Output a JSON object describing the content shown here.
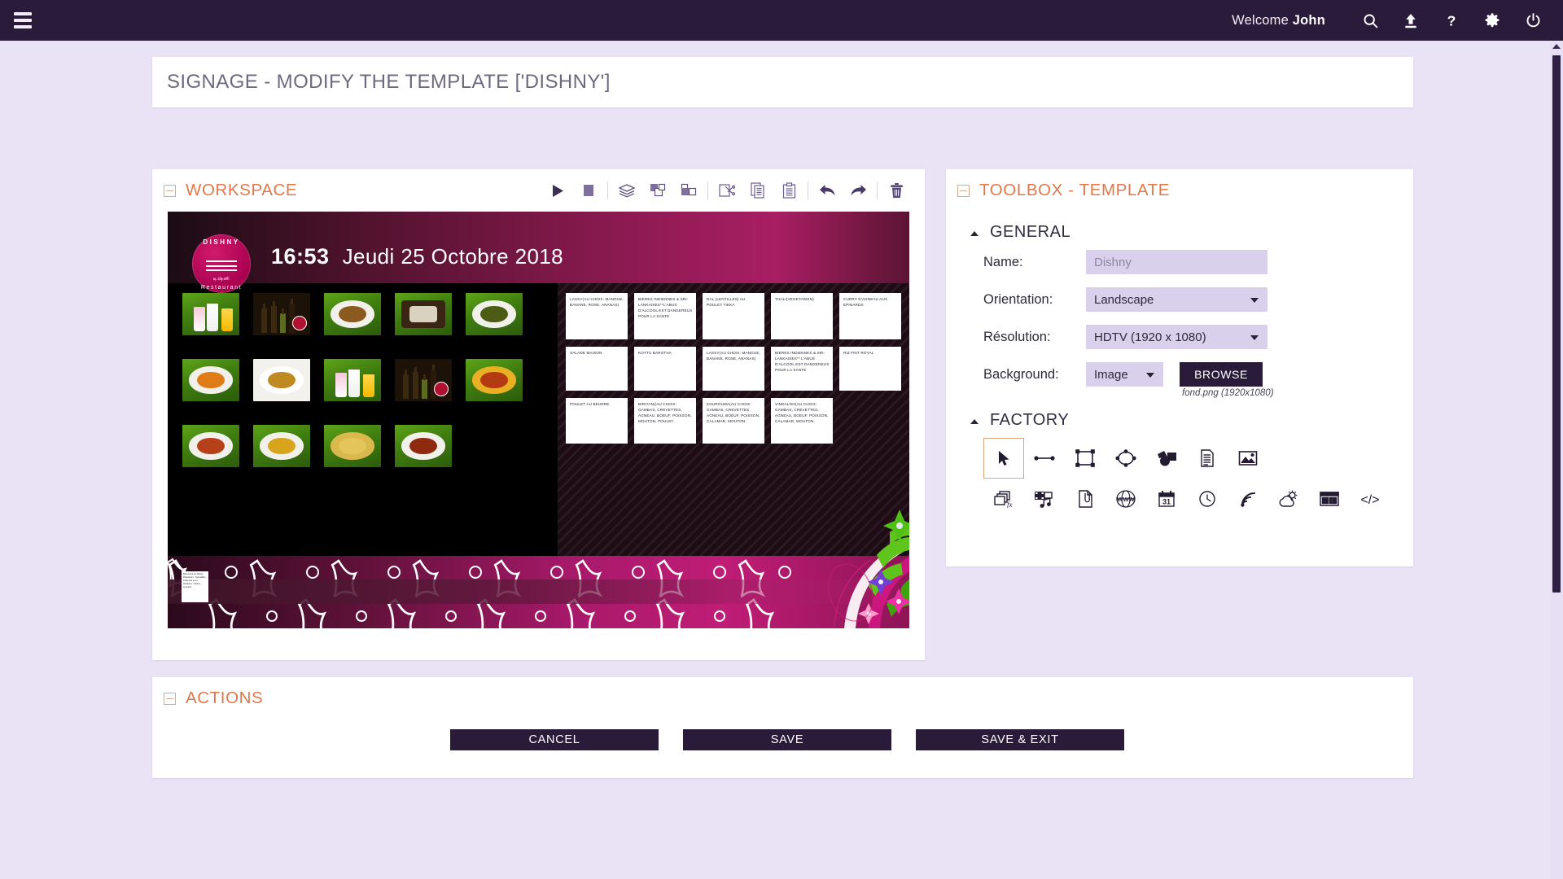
{
  "topbar": {
    "menu_icon": "hamburger-icon",
    "welcome_prefix": "Welcome ",
    "welcome_user": "John",
    "icons": [
      {
        "name": "search-icon",
        "label": "Search"
      },
      {
        "name": "upload-icon",
        "label": "Upload"
      },
      {
        "name": "help-icon",
        "label": "Help"
      },
      {
        "name": "gear-icon",
        "label": "Settings"
      },
      {
        "name": "power-icon",
        "label": "Logout"
      }
    ]
  },
  "page": {
    "title": "SIGNAGE - MODIFY THE TEMPLATE ['DISHNY']"
  },
  "workspace": {
    "title": "WORKSPACE",
    "tools": [
      {
        "name": "play-icon",
        "label": "Play"
      },
      {
        "name": "stop-icon",
        "label": "Stop"
      },
      {
        "name": "layers-icon",
        "label": "Layers"
      },
      {
        "name": "bring-to-front-icon",
        "label": "Bring to front"
      },
      {
        "name": "send-to-back-icon",
        "label": "Send to back"
      },
      {
        "name": "cut-icon",
        "label": "Cut"
      },
      {
        "name": "copy-icon",
        "label": "Copy"
      },
      {
        "name": "paste-icon",
        "label": "Paste"
      },
      {
        "name": "undo-icon",
        "label": "Undo"
      },
      {
        "name": "redo-icon",
        "label": "Redo"
      },
      {
        "name": "delete-icon",
        "label": "Delete"
      }
    ]
  },
  "preview": {
    "logo": {
      "top_text": "DISHNY",
      "tamil_text": "டிஷ்னி",
      "bottom_text": "Restaurant"
    },
    "clock_time": "16:53",
    "clock_date": "Jeudi 25 Octobre 2018",
    "menu_rows": [
      [
        "LASSY(AU CHOIX: MANGUE, BANANE, ROSE, ANANAS)",
        "BIERES INDIENNES & SRI-LANKAISES**L'ABUS D'ALCOOL EST DANGEREUX POUR LA SANTE",
        "DAL (LENTILLES) AU POULET TIKKA",
        "THALI(VEGETARIEN)",
        "CURRY D'AGNEAU AUX EPINARDS"
      ],
      [
        "SALADE MAISON",
        "KOTTU BAROTHA",
        "LASSY(AU CHOIX: MANGUE, BANANE, ROSE, ANANAS)",
        "BIERES INDIENNES & SRI-LANKAISES** L'ABUS D'ALCOOL EST DANGEREUX POUR LA SANTE",
        "RIZ FRIT ROYAL"
      ],
      [
        "POULET AU BEURRE",
        "BIRIYANI(AU CHOIX: GAMBAS, CREVETTES, AGNEAU, BOEUF, POISSON, MOUTON, POULET,",
        "KOUROUMA(AU CHOIX: GAMBAS, CREVETTES, AGNEAU, BOEUF, POISSON, CALAMAR, MOUTON,",
        "VINDALOO(AU CHOIX: GAMBAS, CREVETTES, AGNEAU, BOEUF, POISSON, CALAMAR, MOUTON,"
      ]
    ],
    "ticker_text": "Bienvenue au Dishny Restaurant - Specialites indiennes et sri-lankaises - Plats a emporter"
  },
  "toolbox": {
    "title": "TOOLBOX - TEMPLATE",
    "general": {
      "section_label": "GENERAL",
      "name_label": "Name:",
      "name_value": "",
      "name_placeholder": "Dishny",
      "orientation_label": "Orientation:",
      "orientation_value": "Landscape",
      "resolution_label": "Résolution:",
      "resolution_value": "HDTV (1920 x 1080)",
      "background_label": "Background:",
      "background_value": "Image",
      "browse_label": "BROWSE",
      "background_file": "fond.png (1920x1080)"
    },
    "factory": {
      "section_label": "FACTORY",
      "row1": [
        {
          "name": "select-cursor-icon",
          "label": "Select",
          "selected": true
        },
        {
          "name": "line-icon",
          "label": "Line",
          "selected": false
        },
        {
          "name": "rectangle-icon",
          "label": "Rectangle",
          "selected": false
        },
        {
          "name": "ellipse-icon",
          "label": "Ellipse",
          "selected": false
        },
        {
          "name": "shape-fill-icon",
          "label": "Shape",
          "selected": false
        },
        {
          "name": "text-document-icon",
          "label": "Text",
          "selected": false
        },
        {
          "name": "image-icon",
          "label": "Image",
          "selected": false
        }
      ],
      "row2": [
        {
          "name": "slideshow-fx-icon",
          "label": "Slideshow"
        },
        {
          "name": "video-media-icon",
          "label": "Video"
        },
        {
          "name": "file-clip-icon",
          "label": "File"
        },
        {
          "name": "www-globe-icon",
          "label": "Web page"
        },
        {
          "name": "calendar-icon",
          "label": "Calendar"
        },
        {
          "name": "clock-icon",
          "label": "Clock"
        },
        {
          "name": "rss-icon",
          "label": "RSS feed"
        },
        {
          "name": "weather-icon",
          "label": "Weather"
        },
        {
          "name": "ticker-banner-icon",
          "label": "Ticker"
        },
        {
          "name": "html-code-icon",
          "label": "HTML"
        }
      ]
    }
  },
  "actions": {
    "title": "ACTIONS",
    "buttons": [
      {
        "name": "cancel-button",
        "label": "CANCEL"
      },
      {
        "name": "save-button",
        "label": "SAVE"
      },
      {
        "name": "save-exit-button",
        "label": "SAVE & EXIT"
      }
    ]
  },
  "colors": {
    "topbar": "#2a1b3b",
    "page_bg": "#eae2f5",
    "accent_orange": "#e2784a",
    "field_bg": "#d9d0ec"
  }
}
